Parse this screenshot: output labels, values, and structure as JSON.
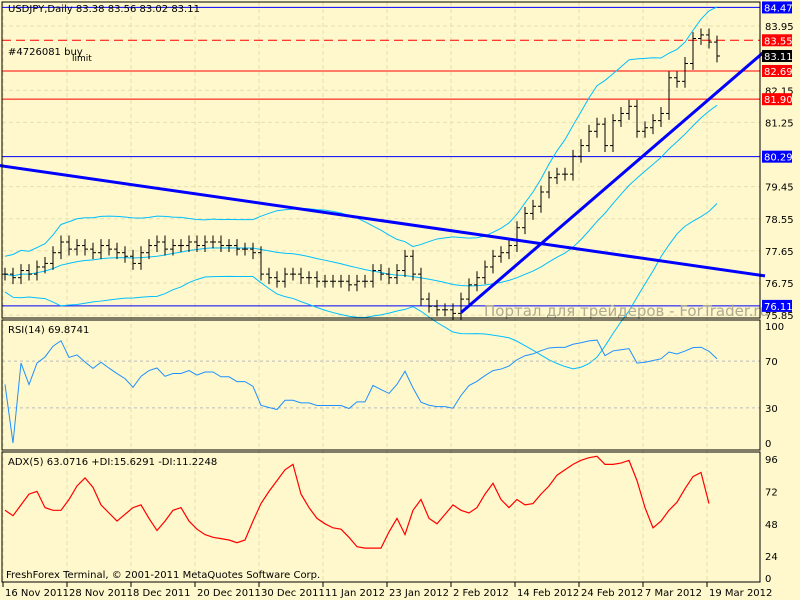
{
  "header": {
    "title": "USDJPY,Daily  83.38 83.56 83.02 83.11"
  },
  "orders": {
    "order1": "#4726081 buy",
    "order2": "limit"
  },
  "watermark": "Портал для трейдеров - ForTrader.ru",
  "copyright": "FreshForex Terminal, © 2001-2011 MetaQuotes Software Corp.",
  "rsi_label": "RSI(14) 69.8741",
  "adx_label": "ADX(5) 63.0716 +DI:15.6291 -DI:11.2248",
  "colors": {
    "bg": "#fff8cc",
    "blue": "#0000ff",
    "red": "#ff0000",
    "band": "#00bfff",
    "adx": "#ff0000",
    "rsi": "#1e90ff"
  },
  "chart_data": {
    "type": "ohlc",
    "symbol": "USDJPY",
    "timeframe": "Daily",
    "price_ticks": [
      "83.95",
      "82.15",
      "81.25",
      "79.45",
      "78.55",
      "77.65",
      "76.75",
      "75.85"
    ],
    "price_range": [
      75.85,
      84.47
    ],
    "levels": [
      {
        "price": 84.47,
        "label": "84.47",
        "color": "#0000ff",
        "style": "solid"
      },
      {
        "price": 83.55,
        "label": "83.55",
        "color": "#ff0000",
        "style": "dashed"
      },
      {
        "price": 82.69,
        "label": "82.69",
        "color": "#ff0000",
        "style": "solid"
      },
      {
        "price": 81.9,
        "label": "81.90",
        "color": "#ff0000",
        "style": "solid"
      },
      {
        "price": 80.29,
        "label": "80.29",
        "color": "#0000ff",
        "style": "solid"
      },
      {
        "price": 76.11,
        "label": "76.11",
        "color": "#0000ff",
        "style": "solid"
      }
    ],
    "current_price": {
      "price": 83.11,
      "label": "83.11"
    },
    "trendlines": [
      {
        "from": [
          -1,
          80.05
        ],
        "to": [
          95,
          76.95
        ]
      },
      {
        "from": [
          57,
          75.92
        ],
        "to": [
          95,
          83.25
        ]
      }
    ],
    "closes": [
      77.0,
      76.9,
      77.1,
      77.0,
      77.2,
      77.3,
      77.6,
      77.9,
      77.7,
      77.8,
      77.7,
      77.6,
      77.8,
      77.7,
      77.6,
      77.5,
      77.3,
      77.6,
      77.8,
      77.9,
      77.7,
      77.8,
      77.8,
      77.9,
      77.8,
      77.9,
      77.9,
      77.8,
      77.8,
      77.7,
      77.7,
      77.6,
      77.0,
      76.9,
      76.8,
      77.0,
      77.0,
      76.9,
      76.9,
      76.8,
      76.8,
      76.8,
      76.8,
      76.7,
      76.8,
      76.8,
      77.1,
      77.0,
      76.9,
      77.1,
      77.5,
      77.0,
      76.3,
      76.1,
      76.0,
      76.0,
      75.9,
      76.3,
      76.7,
      76.9,
      77.2,
      77.5,
      77.6,
      77.8,
      78.3,
      78.7,
      78.9,
      79.3,
      79.7,
      79.8,
      79.8,
      80.3,
      80.6,
      81.0,
      81.2,
      80.6,
      81.3,
      81.5,
      81.7,
      81.0,
      81.1,
      81.3,
      81.5,
      82.5,
      82.4,
      82.9,
      83.6,
      83.7,
      83.5,
      83.11
    ],
    "rsi_ticks": [
      "100",
      "70",
      "30",
      "0"
    ],
    "adx_ticks": [
      "96",
      "72",
      "48",
      "24",
      "0"
    ],
    "adx": [
      58,
      54,
      62,
      70,
      72,
      60,
      58,
      58,
      66,
      76,
      82,
      75,
      62,
      56,
      50,
      55,
      60,
      62,
      52,
      43,
      50,
      58,
      60,
      50,
      44,
      40,
      38,
      37,
      36,
      34,
      36,
      50,
      63,
      72,
      80,
      88,
      92,
      70,
      60,
      52,
      48,
      45,
      44,
      38,
      31,
      30,
      30,
      30,
      42,
      52,
      40,
      58,
      66,
      52,
      48,
      55,
      62,
      58,
      56,
      60,
      70,
      78,
      66,
      60,
      66,
      62,
      63,
      70,
      76,
      84,
      88,
      92,
      95,
      97,
      98,
      92,
      92,
      93,
      95,
      80,
      60,
      45,
      50,
      58,
      64,
      74,
      83,
      86,
      63
    ],
    "date_labels": [
      "16 Nov 2011",
      "28 Nov 2011",
      "8 Dec 2011",
      "20 Dec 2011",
      "30 Dec 2011",
      "11 Jan 2012",
      "23 Jan 2012",
      "2 Feb 2012",
      "14 Feb 2012",
      "24 Feb 2012",
      "7 Mar 2012",
      "19 Mar 2012"
    ]
  }
}
